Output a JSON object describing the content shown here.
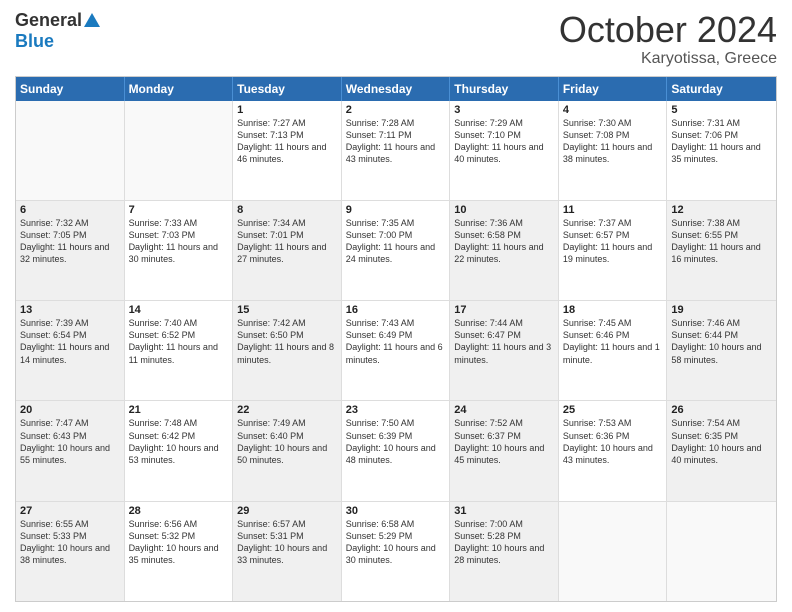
{
  "logo": {
    "general": "General",
    "blue": "Blue"
  },
  "title": {
    "month": "October 2024",
    "location": "Karyotissa, Greece"
  },
  "weekdays": [
    "Sunday",
    "Monday",
    "Tuesday",
    "Wednesday",
    "Thursday",
    "Friday",
    "Saturday"
  ],
  "rows": [
    [
      {
        "day": "",
        "text": "",
        "empty": true
      },
      {
        "day": "",
        "text": "",
        "empty": true
      },
      {
        "day": "1",
        "text": "Sunrise: 7:27 AM\nSunset: 7:13 PM\nDaylight: 11 hours and 46 minutes."
      },
      {
        "day": "2",
        "text": "Sunrise: 7:28 AM\nSunset: 7:11 PM\nDaylight: 11 hours and 43 minutes."
      },
      {
        "day": "3",
        "text": "Sunrise: 7:29 AM\nSunset: 7:10 PM\nDaylight: 11 hours and 40 minutes."
      },
      {
        "day": "4",
        "text": "Sunrise: 7:30 AM\nSunset: 7:08 PM\nDaylight: 11 hours and 38 minutes."
      },
      {
        "day": "5",
        "text": "Sunrise: 7:31 AM\nSunset: 7:06 PM\nDaylight: 11 hours and 35 minutes."
      }
    ],
    [
      {
        "day": "6",
        "text": "Sunrise: 7:32 AM\nSunset: 7:05 PM\nDaylight: 11 hours and 32 minutes.",
        "shaded": true
      },
      {
        "day": "7",
        "text": "Sunrise: 7:33 AM\nSunset: 7:03 PM\nDaylight: 11 hours and 30 minutes."
      },
      {
        "day": "8",
        "text": "Sunrise: 7:34 AM\nSunset: 7:01 PM\nDaylight: 11 hours and 27 minutes.",
        "shaded": true
      },
      {
        "day": "9",
        "text": "Sunrise: 7:35 AM\nSunset: 7:00 PM\nDaylight: 11 hours and 24 minutes."
      },
      {
        "day": "10",
        "text": "Sunrise: 7:36 AM\nSunset: 6:58 PM\nDaylight: 11 hours and 22 minutes.",
        "shaded": true
      },
      {
        "day": "11",
        "text": "Sunrise: 7:37 AM\nSunset: 6:57 PM\nDaylight: 11 hours and 19 minutes."
      },
      {
        "day": "12",
        "text": "Sunrise: 7:38 AM\nSunset: 6:55 PM\nDaylight: 11 hours and 16 minutes.",
        "shaded": true
      }
    ],
    [
      {
        "day": "13",
        "text": "Sunrise: 7:39 AM\nSunset: 6:54 PM\nDaylight: 11 hours and 14 minutes.",
        "shaded": true
      },
      {
        "day": "14",
        "text": "Sunrise: 7:40 AM\nSunset: 6:52 PM\nDaylight: 11 hours and 11 minutes."
      },
      {
        "day": "15",
        "text": "Sunrise: 7:42 AM\nSunset: 6:50 PM\nDaylight: 11 hours and 8 minutes.",
        "shaded": true
      },
      {
        "day": "16",
        "text": "Sunrise: 7:43 AM\nSunset: 6:49 PM\nDaylight: 11 hours and 6 minutes."
      },
      {
        "day": "17",
        "text": "Sunrise: 7:44 AM\nSunset: 6:47 PM\nDaylight: 11 hours and 3 minutes.",
        "shaded": true
      },
      {
        "day": "18",
        "text": "Sunrise: 7:45 AM\nSunset: 6:46 PM\nDaylight: 11 hours and 1 minute."
      },
      {
        "day": "19",
        "text": "Sunrise: 7:46 AM\nSunset: 6:44 PM\nDaylight: 10 hours and 58 minutes.",
        "shaded": true
      }
    ],
    [
      {
        "day": "20",
        "text": "Sunrise: 7:47 AM\nSunset: 6:43 PM\nDaylight: 10 hours and 55 minutes.",
        "shaded": true
      },
      {
        "day": "21",
        "text": "Sunrise: 7:48 AM\nSunset: 6:42 PM\nDaylight: 10 hours and 53 minutes."
      },
      {
        "day": "22",
        "text": "Sunrise: 7:49 AM\nSunset: 6:40 PM\nDaylight: 10 hours and 50 minutes.",
        "shaded": true
      },
      {
        "day": "23",
        "text": "Sunrise: 7:50 AM\nSunset: 6:39 PM\nDaylight: 10 hours and 48 minutes."
      },
      {
        "day": "24",
        "text": "Sunrise: 7:52 AM\nSunset: 6:37 PM\nDaylight: 10 hours and 45 minutes.",
        "shaded": true
      },
      {
        "day": "25",
        "text": "Sunrise: 7:53 AM\nSunset: 6:36 PM\nDaylight: 10 hours and 43 minutes."
      },
      {
        "day": "26",
        "text": "Sunrise: 7:54 AM\nSunset: 6:35 PM\nDaylight: 10 hours and 40 minutes.",
        "shaded": true
      }
    ],
    [
      {
        "day": "27",
        "text": "Sunrise: 6:55 AM\nSunset: 5:33 PM\nDaylight: 10 hours and 38 minutes.",
        "shaded": true
      },
      {
        "day": "28",
        "text": "Sunrise: 6:56 AM\nSunset: 5:32 PM\nDaylight: 10 hours and 35 minutes."
      },
      {
        "day": "29",
        "text": "Sunrise: 6:57 AM\nSunset: 5:31 PM\nDaylight: 10 hours and 33 minutes.",
        "shaded": true
      },
      {
        "day": "30",
        "text": "Sunrise: 6:58 AM\nSunset: 5:29 PM\nDaylight: 10 hours and 30 minutes."
      },
      {
        "day": "31",
        "text": "Sunrise: 7:00 AM\nSunset: 5:28 PM\nDaylight: 10 hours and 28 minutes.",
        "shaded": true
      },
      {
        "day": "",
        "text": "",
        "empty": true
      },
      {
        "day": "",
        "text": "",
        "empty": true
      }
    ]
  ]
}
